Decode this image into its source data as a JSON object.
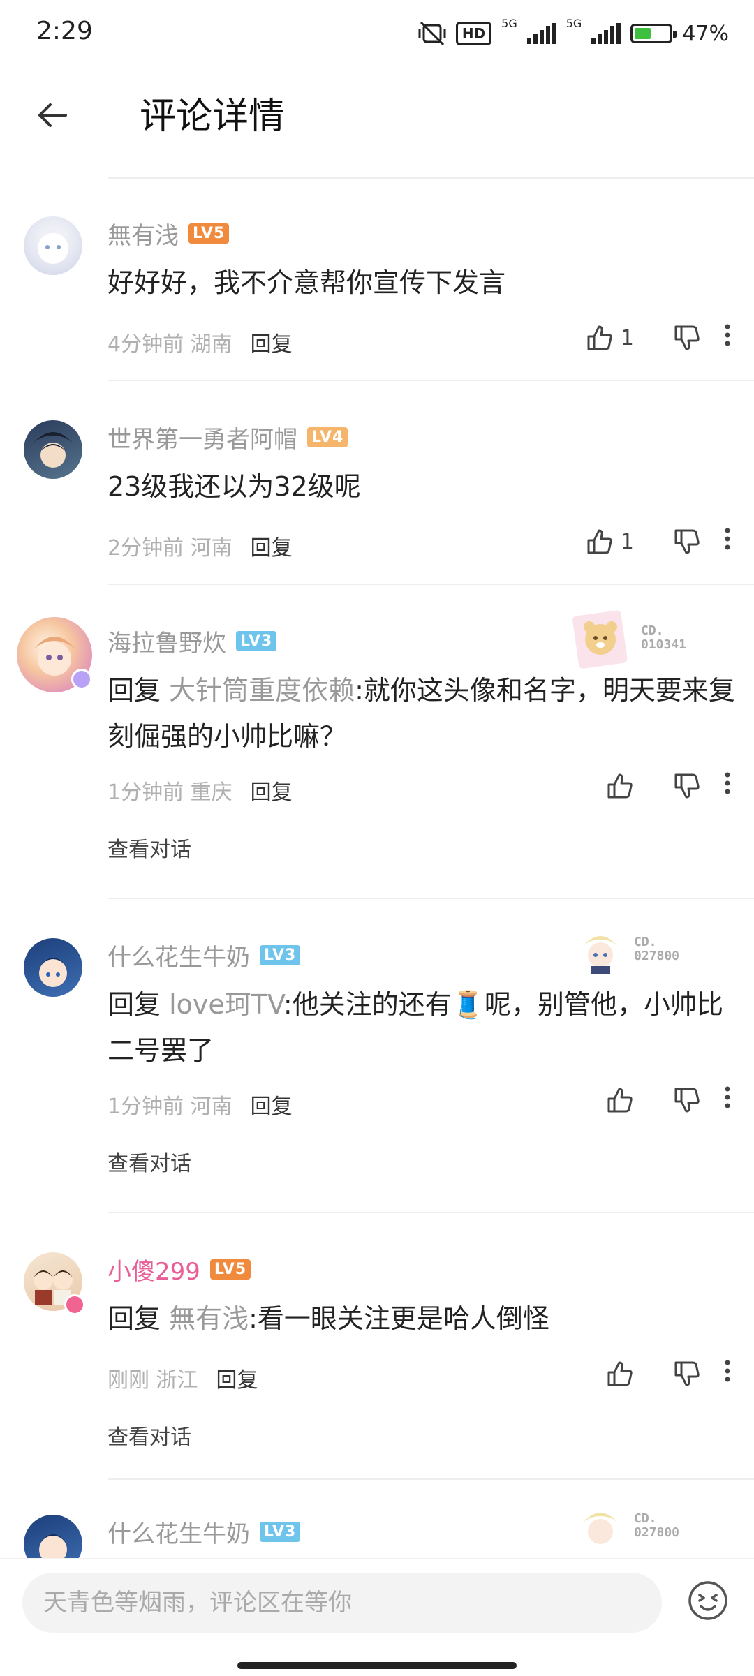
{
  "status_bar": {
    "time": "2:29",
    "battery": "47%",
    "network1": "5G",
    "network2": "5G",
    "hd": "HD",
    "battery_level": 0.47
  },
  "header": {
    "title": "评论详情"
  },
  "comments": [
    {
      "name": "無有浅",
      "level": "LV5",
      "level_color": "#f08a3c",
      "text": "好好好，我不介意帮你宣传下发言",
      "time": "4分钟前",
      "location": "湖南",
      "reply_label": "回复",
      "likes": "1"
    },
    {
      "name": "世界第一勇者阿帽",
      "level": "LV4",
      "level_color": "#f5b56a",
      "text": "23级我还以为32级呢",
      "time": "2分钟前",
      "location": "河南",
      "reply_label": "回复",
      "likes": "1"
    },
    {
      "name": "海拉鲁野炊",
      "level": "LV3",
      "level_color": "#6fc4ec",
      "reply_prefix": "回复",
      "mention": "大针筒重度依赖",
      "text": ":就你这头像和名字，明天要来复刻倔强的小帅比嘛？",
      "time": "1分钟前",
      "location": "重庆",
      "reply_label": "回复",
      "view_conversation": "查看对话",
      "deco_line1": "CD.",
      "deco_line2": "010341"
    },
    {
      "name": "什么花生牛奶",
      "level": "LV3",
      "level_color": "#6fc4ec",
      "reply_prefix": "回复",
      "mention": "love珂TV",
      "text_before": ":他关注的还有",
      "emoji": "🧵",
      "text_after": "呢，别管他，小帅比二号罢了",
      "time": "1分钟前",
      "location": "河南",
      "reply_label": "回复",
      "view_conversation": "查看对话",
      "deco_line1": "CD.",
      "deco_line2": "027800"
    },
    {
      "name": "小傻299",
      "level": "LV5",
      "level_color": "#f08a3c",
      "name_color": "#e85f98",
      "reply_prefix": "回复",
      "mention": "無有浅",
      "text": ":看一眼关注更是哈人倒怪",
      "time": "刚刚",
      "location": "浙江",
      "reply_label": "回复",
      "view_conversation": "查看对话"
    },
    {
      "name": "什么花生牛奶",
      "level": "LV3",
      "level_color": "#6fc4ec",
      "deco_line1": "CD.",
      "deco_line2": "027800"
    }
  ],
  "input": {
    "placeholder": "天青色等烟雨，评论区在等你"
  }
}
